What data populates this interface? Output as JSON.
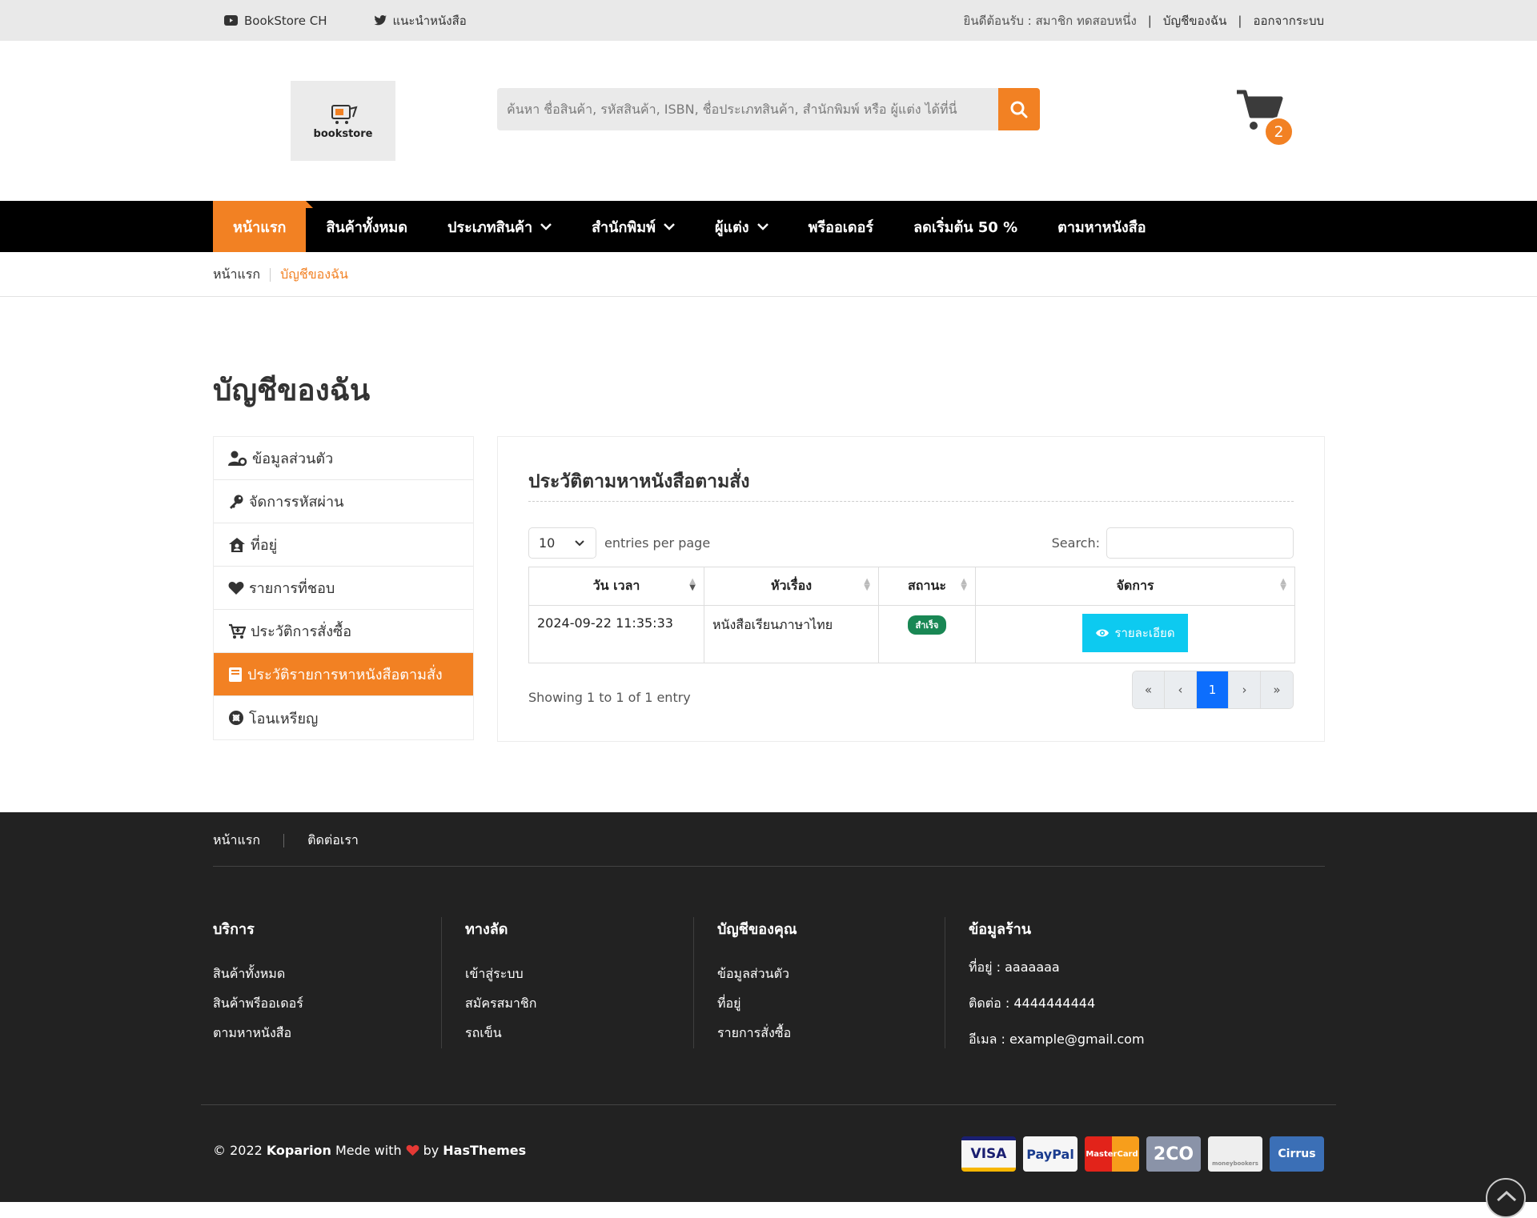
{
  "topbar": {
    "youtube_label": "BookStore CH",
    "twitter_label": "แนะนำหนังสือ",
    "welcome": "ยินดีต้อนรับ : สมาชิก ทดสอบหนึ่ง",
    "account_link": "บัญชีของฉัน",
    "logout_link": "ออกจากระบบ"
  },
  "header": {
    "logo_text": "bookstore",
    "search_placeholder": "ค้นหา ชื่อสินค้า, รหัสสินค้า, ISBN, ชื่อประเภทสินค้า, สำนักพิมพ์ หรือ ผู้แต่ง ได้ที่นี่",
    "cart_count": "2"
  },
  "nav": {
    "items": [
      {
        "label": "หน้าแรก"
      },
      {
        "label": "สินค้าทั้งหมด"
      },
      {
        "label": "ประเภทสินค้า"
      },
      {
        "label": "สำนักพิมพ์"
      },
      {
        "label": "ผู้แต่ง"
      },
      {
        "label": "พรีออเดอร์"
      },
      {
        "label": "ลดเริ่มต้น 50 %"
      },
      {
        "label": "ตามหาหนังสือ"
      }
    ]
  },
  "breadcrumb": {
    "home": "หน้าแรก",
    "current": "บัญชีของฉัน"
  },
  "page": {
    "title": "บัญชีของฉัน"
  },
  "sidebar": {
    "items": [
      {
        "label": "ข้อมูลส่วนตัว"
      },
      {
        "label": "จัดการรหัสผ่าน"
      },
      {
        "label": "ที่อยู่"
      },
      {
        "label": "รายการที่ชอบ"
      },
      {
        "label": "ประวัติการสั่งซื้อ"
      },
      {
        "label": "ประวัติรายการหาหนังสือตามสั่ง"
      },
      {
        "label": "โอนเหรียญ"
      }
    ]
  },
  "panel": {
    "title": "ประวัติตามหาหนังสือตามสั่ง",
    "entries_value": "10",
    "entries_label": "entries per page",
    "search_label": "Search:",
    "columns": [
      "วัน เวลา",
      "หัวเรื่อง",
      "สถานะ",
      "จัดการ"
    ],
    "rows": [
      {
        "datetime": "2024-09-22 11:35:33",
        "subject": "หนังสือเรียนภาษาไทย",
        "status": "สำเร็จ",
        "action": "รายละเอียด"
      }
    ],
    "showing": "Showing 1 to 1 of 1 entry",
    "pager": {
      "first": "«",
      "prev": "‹",
      "page": "1",
      "next": "›",
      "last": "»"
    }
  },
  "footer": {
    "links": [
      "หน้าแรก",
      "ติดต่อเรา"
    ],
    "columns": [
      {
        "title": "บริการ",
        "items": [
          "สินค้าทั้งหมด",
          "สินค้าพรีออเดอร์",
          "ตามหาหนังสือ"
        ]
      },
      {
        "title": "ทางลัด",
        "items": [
          "เข้าสู่ระบบ",
          "สมัครสมาชิก",
          "รถเข็น"
        ]
      },
      {
        "title": "บัญชีของคุณ",
        "items": [
          "ข้อมูลส่วนตัว",
          "ที่อยู่",
          "รายการสั่งซื้อ"
        ]
      },
      {
        "title": "ข้อมูลร้าน",
        "items": [
          "ที่อยู่ : aaaaaaa",
          "ติดต่อ : 4444444444",
          "อีเมล : example@gmail.com"
        ]
      }
    ],
    "copyright_prefix": "© 2022",
    "brand": "Koparion",
    "made_with": "Mede with",
    "by": "by",
    "author": "HasThemes",
    "payments": [
      "VISA",
      "PayPal",
      "MasterCard",
      "2CO",
      "moneybookers",
      "Cirrus"
    ]
  },
  "colors": {
    "accent": "#f28123",
    "nav_bg": "#000000",
    "footer_bg": "#222222",
    "primary": "#0d6efd",
    "info": "#0dcaf0",
    "success": "#198754"
  }
}
